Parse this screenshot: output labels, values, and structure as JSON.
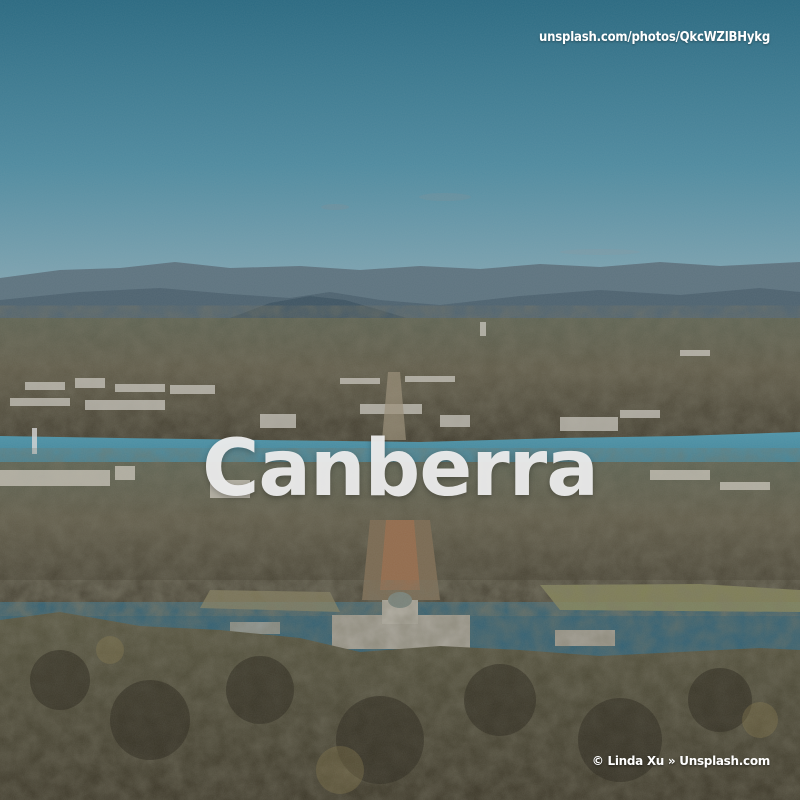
{
  "image": {
    "title": "Canberra",
    "source_url": "unsplash.com/photos/QkcWZlBHykg",
    "credit": "© Linda Xu » Unsplash.com"
  },
  "colors": {
    "sky_top": "#2e6f86",
    "sky_bottom": "#7aa0ae",
    "mountains": "#4f6775",
    "lake": "#4a8ea4",
    "trees": "#4b4a35",
    "title_text": "#eeeeee"
  }
}
